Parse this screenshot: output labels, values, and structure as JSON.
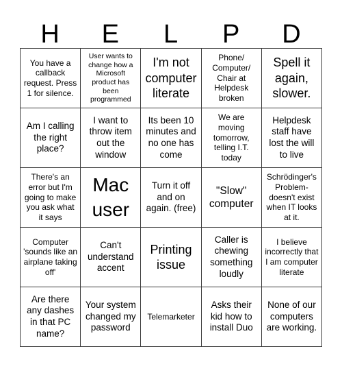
{
  "card": {
    "title_letters": [
      "H",
      "E",
      "L",
      "P",
      "D"
    ],
    "columns": 5,
    "rows": 5,
    "border_color": "#3a3a3a",
    "cell_background": "#ffffff",
    "text_color": "#000000",
    "cells": [
      [
        {
          "text": "You have a callback request. Press 1 for silence.",
          "size": "s"
        },
        {
          "text": "User wants to change how a Microsoft product has been programmed",
          "size": "xs"
        },
        {
          "text": "I'm not computer literate",
          "size": "xl"
        },
        {
          "text": "Phone/ Computer/ Chair at Helpdesk broken",
          "size": "s"
        },
        {
          "text": "Spell it again, slower.",
          "size": "xl"
        }
      ],
      [
        {
          "text": "Am I calling the right place?",
          "size": "m"
        },
        {
          "text": "I want to throw item out the window",
          "size": "m"
        },
        {
          "text": "Its been 10 minutes and no one has come",
          "size": "m"
        },
        {
          "text": "We are moving tomorrow, telling I.T. today",
          "size": "s"
        },
        {
          "text": "Helpdesk staff have lost the will to live",
          "size": "m"
        }
      ],
      [
        {
          "text": "There's an error but I'm going to make you ask what it says",
          "size": "s"
        },
        {
          "text": "Mac user",
          "size": "xxl"
        },
        {
          "text": "Turn it off and on again. (free)",
          "size": "m"
        },
        {
          "text": "\"Slow\" computer",
          "size": "l"
        },
        {
          "text": "Schrödinger's Problem- doesn't exist when IT looks at it.",
          "size": "s"
        }
      ],
      [
        {
          "text": "Computer 'sounds like an airplane taking off'",
          "size": "s"
        },
        {
          "text": "Can't understand accent",
          "size": "m"
        },
        {
          "text": "Printing issue",
          "size": "xl"
        },
        {
          "text": "Caller is chewing something loudly",
          "size": "m"
        },
        {
          "text": "I believe incorrectly that I am computer literate",
          "size": "s"
        }
      ],
      [
        {
          "text": "Are there any dashes in that PC name?",
          "size": "m"
        },
        {
          "text": "Your system changed my password",
          "size": "m"
        },
        {
          "text": "Telemarketer",
          "size": "s"
        },
        {
          "text": "Asks their kid how to install Duo",
          "size": "m"
        },
        {
          "text": "None of our computers are working.",
          "size": "m"
        }
      ]
    ]
  }
}
